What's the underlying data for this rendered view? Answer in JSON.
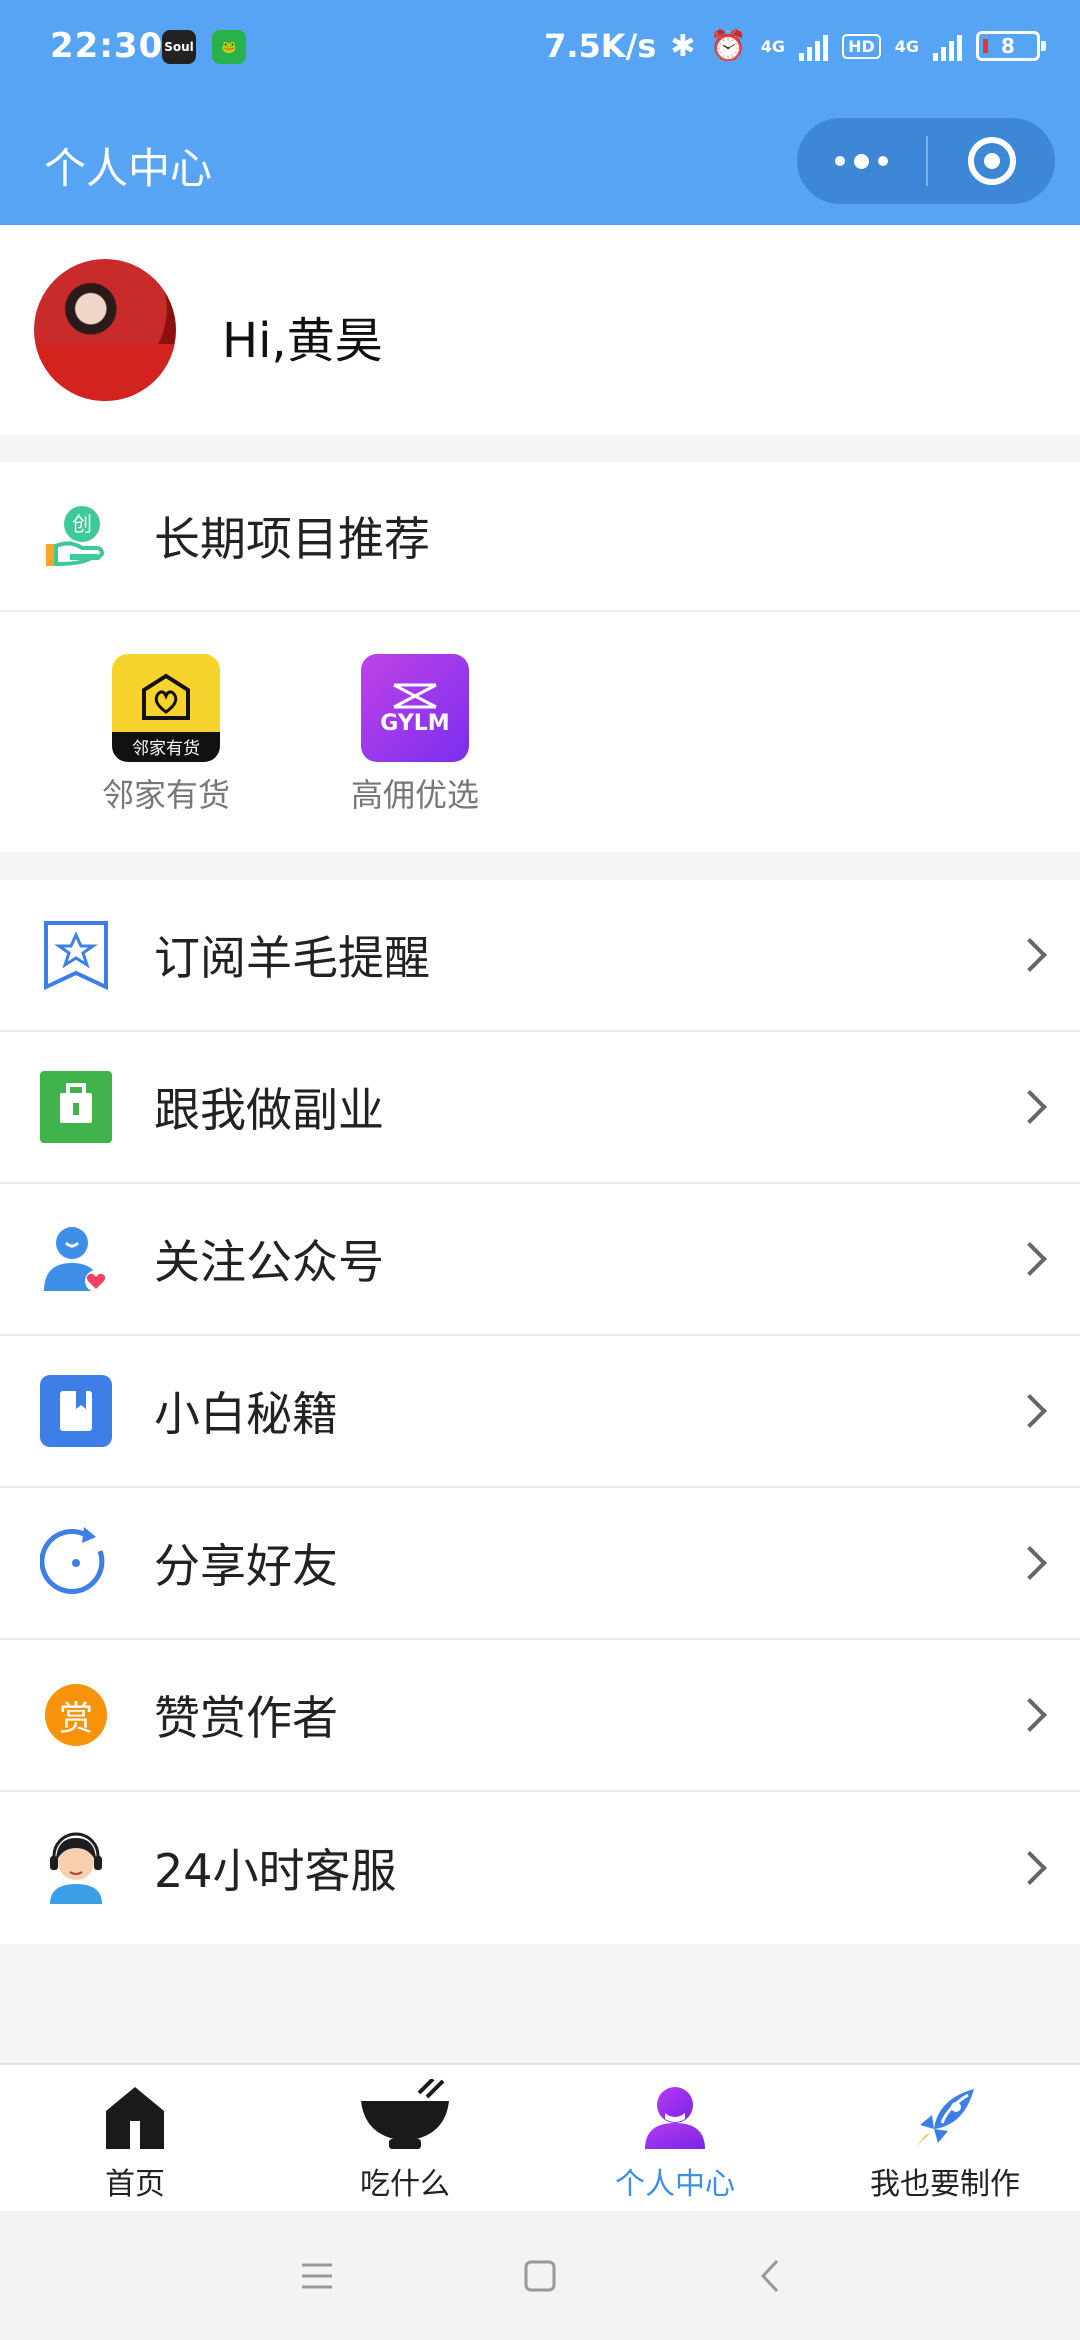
{
  "status_bar": {
    "time": "22:30",
    "apps": [
      "Soul",
      "frog"
    ],
    "network_speed": "7.5K/s",
    "network_type_1": "4G",
    "hd_label": "HD",
    "network_type_2": "4G",
    "battery": "8",
    "battery_color": "#e0382f"
  },
  "nav": {
    "title": "个人中心",
    "more_icon": "more-dots-icon",
    "close_icon": "target-close-icon",
    "bar_color": "#57a4f5"
  },
  "profile": {
    "greeting": "Hi,黄昊"
  },
  "projects": {
    "title": "长期项目推荐",
    "apps": [
      {
        "name": "邻家有货",
        "logo_text": "邻家有货"
      },
      {
        "name": "高佣优选",
        "logo_text": "GYLM"
      }
    ]
  },
  "menu": {
    "items": [
      {
        "label": "订阅羊毛提醒",
        "icon": "bookmark-star-icon"
      },
      {
        "label": "跟我做副业",
        "icon": "briefcase-icon"
      },
      {
        "label": "关注公众号",
        "icon": "user-heart-icon"
      },
      {
        "label": "小白秘籍",
        "icon": "book-icon"
      },
      {
        "label": "分享好友",
        "icon": "share-refresh-icon"
      },
      {
        "label": "赞赏作者",
        "icon": "reward-icon"
      },
      {
        "label": "24小时客服",
        "icon": "customer-service-icon"
      }
    ],
    "reward_badge": "赏"
  },
  "tabbar": {
    "tabs": [
      {
        "label": "首页",
        "icon": "home-icon",
        "active": false
      },
      {
        "label": "吃什么",
        "icon": "bowl-icon",
        "active": false
      },
      {
        "label": "个人中心",
        "icon": "profile-icon",
        "active": true
      },
      {
        "label": "我也要制作",
        "icon": "rocket-icon",
        "active": false
      }
    ],
    "active_color": "#3d8fe8"
  }
}
